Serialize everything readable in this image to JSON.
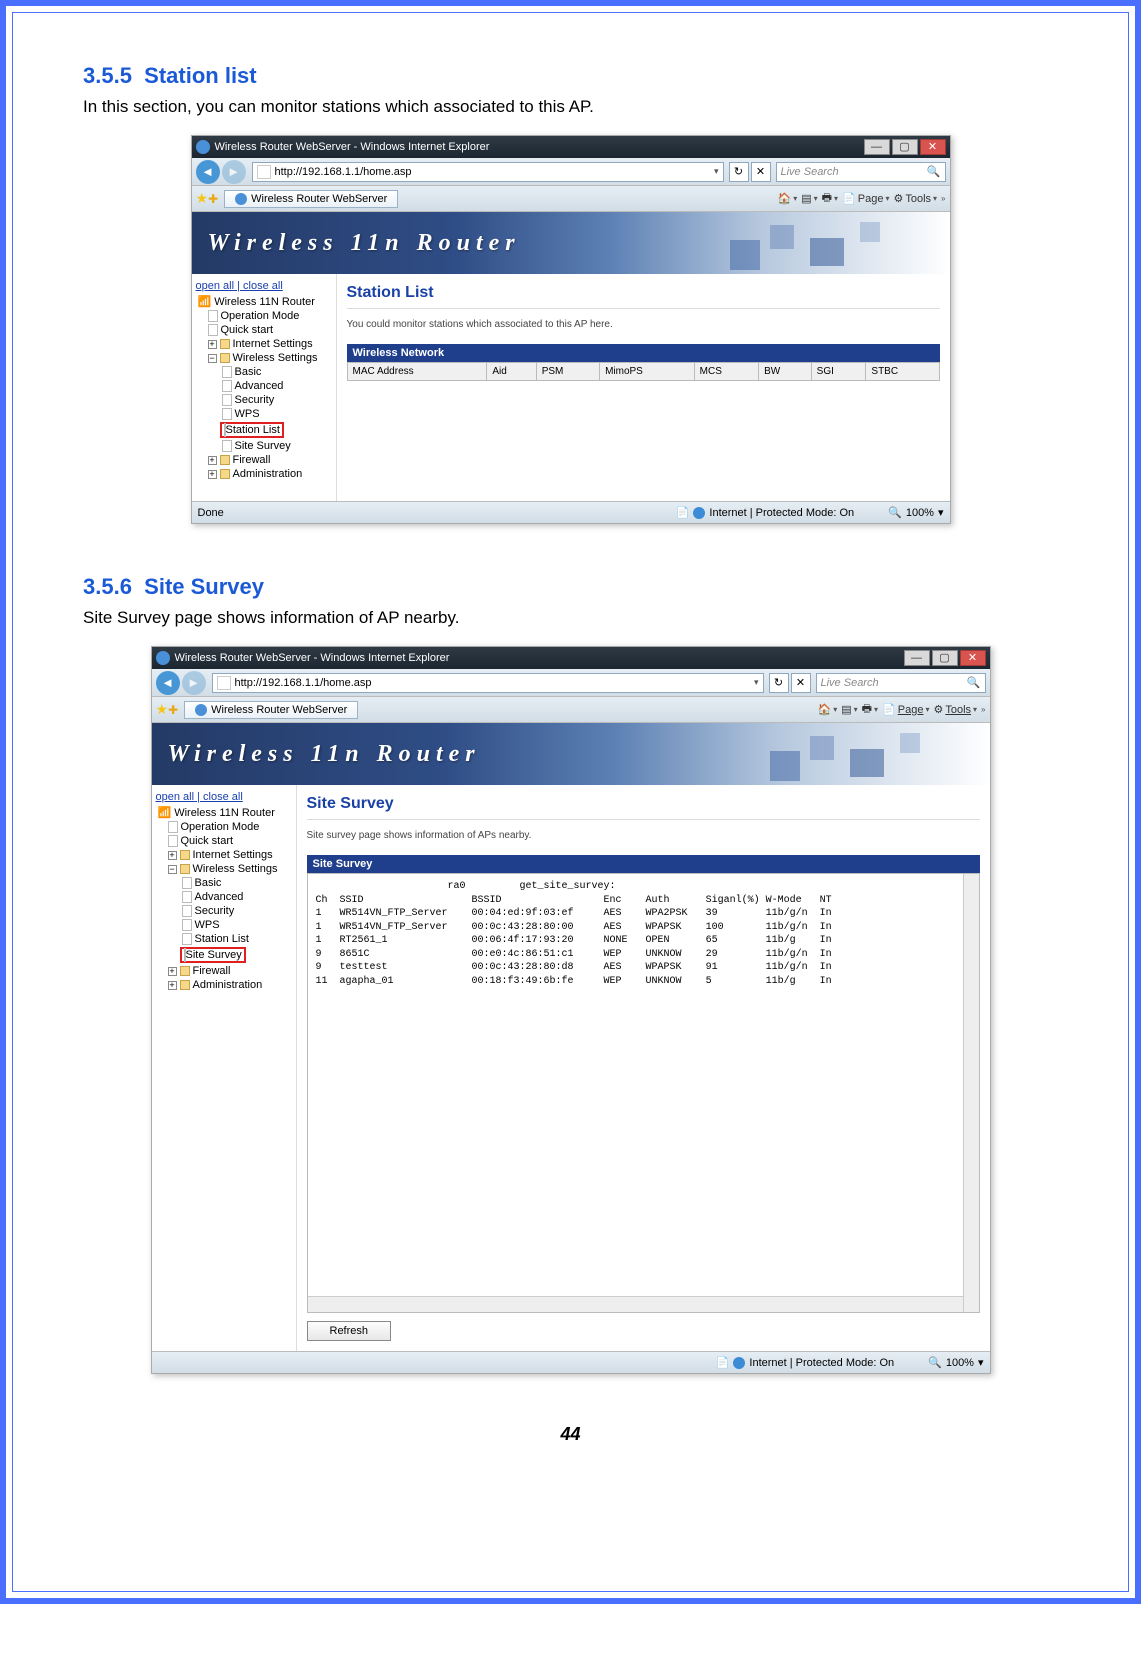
{
  "sections": {
    "s1": {
      "num": "3.5.5",
      "title": "Station list",
      "text": "In this section, you can monitor stations which associated to this AP."
    },
    "s2": {
      "num": "3.5.6",
      "title": "Site Survey",
      "text": "Site Survey page shows information of AP nearby."
    }
  },
  "browser": {
    "title": "Wireless Router WebServer - Windows Internet Explorer",
    "url": "http://192.168.1.1/home.asp",
    "search_placeholder": "Live Search",
    "tab_title": "Wireless Router WebServer",
    "tools_page": "Page",
    "tools_tools": "Tools",
    "status_done": "Done",
    "status_zone": "Internet | Protected Mode: On",
    "zoom": "100%"
  },
  "banner": "Wireless 11n Router",
  "nav": {
    "open_all": "open all",
    "close_all": "close all",
    "root": "Wireless 11N Router",
    "op_mode": "Operation Mode",
    "quick": "Quick start",
    "inet": "Internet Settings",
    "wset": "Wireless Settings",
    "basic": "Basic",
    "adv": "Advanced",
    "sec": "Security",
    "wps": "WPS",
    "stationlist": "Station List",
    "sitesurvey": "Site Survey",
    "firewall": "Firewall",
    "admin": "Administration"
  },
  "station": {
    "title": "Station List",
    "desc": "You could monitor stations which associated to this AP here.",
    "table_head": "Wireless Network",
    "cols": [
      "MAC Address",
      "Aid",
      "PSM",
      "MimoPS",
      "MCS",
      "BW",
      "SGI",
      "STBC"
    ]
  },
  "survey": {
    "title": "Site Survey",
    "desc": "Site survey page shows information of APs nearby.",
    "table_head": "Site Survey",
    "refresh": "Refresh",
    "data": {
      "iface": "ra0",
      "cmd": "get_site_survey:",
      "headers": [
        "Ch",
        "SSID",
        "BSSID",
        "Enc",
        "Auth",
        "Siganl(%)",
        "W-Mode",
        "NT"
      ],
      "rows": [
        [
          "1",
          "WR514VN_FTP_Server",
          "00:04:ed:9f:03:ef",
          "AES",
          "WPA2PSK",
          "39",
          "11b/g/n",
          "In"
        ],
        [
          "1",
          "WR514VN_FTP_Server",
          "00:0c:43:28:80:00",
          "AES",
          "WPAPSK",
          "100",
          "11b/g/n",
          "In"
        ],
        [
          "1",
          "RT2561_1",
          "00:06:4f:17:93:20",
          "NONE",
          "OPEN",
          "65",
          "11b/g",
          "In"
        ],
        [
          "9",
          "8651C",
          "00:e0:4c:86:51:c1",
          "WEP",
          "UNKNOW",
          "29",
          "11b/g/n",
          "In"
        ],
        [
          "9",
          "testtest",
          "00:0c:43:28:80:d8",
          "AES",
          "WPAPSK",
          "91",
          "11b/g/n",
          "In"
        ],
        [
          "11",
          "agapha_01",
          "00:18:f3:49:6b:fe",
          "WEP",
          "UNKNOW",
          "5",
          "11b/g",
          "In"
        ]
      ]
    }
  },
  "page_number": "44"
}
